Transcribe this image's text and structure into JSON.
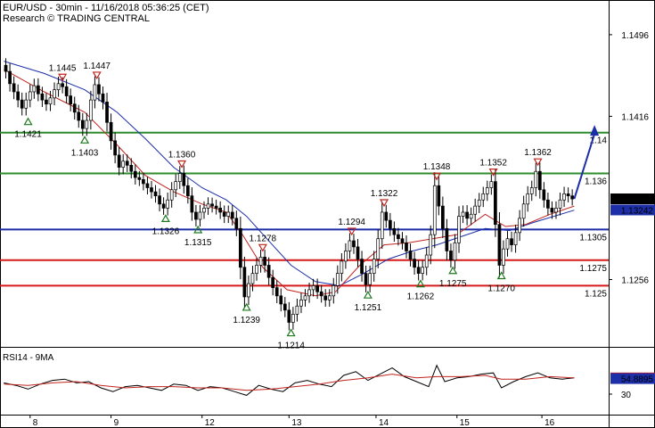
{
  "header": {
    "line1": "EUR/USD - 30min - 11/16/2018 05:36:25 (CET)",
    "line2": "Research © TRADING CENTRAL"
  },
  "rsi_panel_label": "RSI14 - 9MA",
  "chart_data": [
    {
      "type": "candlestick",
      "title": "EUR/USD - 30min - 11/16/2018 05:36:25 (CET)",
      "x_tick_labels": [
        "8",
        "9",
        "12",
        "13",
        "14",
        "15",
        "16"
      ],
      "y_tick_labels": [
        {
          "value": 1.1496,
          "label": "1.1496"
        },
        {
          "value": 1.1416,
          "label": "1.1416"
        },
        {
          "value": 1.1256,
          "label": "1.1256"
        }
      ],
      "ylim": [
        1.119,
        1.153
      ],
      "price_path": [
        [
          1,
          1.1466
        ],
        [
          3,
          1.146
        ],
        [
          5,
          1.1448
        ],
        [
          7,
          1.144
        ],
        [
          9,
          1.1432
        ],
        [
          11,
          1.1424
        ],
        [
          13,
          1.1432
        ],
        [
          15,
          1.144
        ],
        [
          17,
          1.1446
        ],
        [
          19,
          1.1438
        ],
        [
          21,
          1.1432
        ],
        [
          23,
          1.1428
        ],
        [
          25,
          1.1434
        ],
        [
          27,
          1.1442
        ],
        [
          29,
          1.1448
        ],
        [
          31,
          1.1445
        ],
        [
          33,
          1.1436
        ],
        [
          35,
          1.1428
        ],
        [
          37,
          1.142
        ],
        [
          39,
          1.1412
        ],
        [
          41,
          1.1404
        ],
        [
          43,
          1.1412
        ],
        [
          45,
          1.1432
        ],
        [
          47,
          1.1447
        ],
        [
          49,
          1.1438
        ],
        [
          51,
          1.143
        ],
        [
          53,
          1.141
        ],
        [
          55,
          1.1392
        ],
        [
          57,
          1.1378
        ],
        [
          59,
          1.1366
        ],
        [
          61,
          1.1372
        ],
        [
          63,
          1.1368
        ],
        [
          65,
          1.1362
        ],
        [
          67,
          1.1356
        ],
        [
          69,
          1.1354
        ],
        [
          71,
          1.135
        ],
        [
          73,
          1.1346
        ],
        [
          75,
          1.1342
        ],
        [
          77,
          1.1338
        ],
        [
          79,
          1.133
        ],
        [
          81,
          1.1326
        ],
        [
          83,
          1.1334
        ],
        [
          85,
          1.1344
        ],
        [
          87,
          1.1352
        ],
        [
          89,
          1.136
        ],
        [
          91,
          1.1348
        ],
        [
          93,
          1.1338
        ],
        [
          95,
          1.1322
        ],
        [
          97,
          1.1315
        ],
        [
          99,
          1.1322
        ],
        [
          101,
          1.1326
        ],
        [
          103,
          1.133
        ],
        [
          105,
          1.1328
        ],
        [
          107,
          1.1326
        ],
        [
          109,
          1.1322
        ],
        [
          111,
          1.1318
        ],
        [
          113,
          1.1322
        ],
        [
          115,
          1.1316
        ],
        [
          117,
          1.1306
        ],
        [
          119,
          1.1268
        ],
        [
          121,
          1.1239
        ],
        [
          123,
          1.1252
        ],
        [
          125,
          1.1262
        ],
        [
          127,
          1.127
        ],
        [
          129,
          1.1278
        ],
        [
          131,
          1.127
        ],
        [
          133,
          1.1258
        ],
        [
          135,
          1.1248
        ],
        [
          137,
          1.124
        ],
        [
          139,
          1.1232
        ],
        [
          141,
          1.1226
        ],
        [
          143,
          1.1214
        ],
        [
          145,
          1.1222
        ],
        [
          147,
          1.123
        ],
        [
          149,
          1.1236
        ],
        [
          151,
          1.124
        ],
        [
          153,
          1.1246
        ],
        [
          155,
          1.125
        ],
        [
          157,
          1.1244
        ],
        [
          159,
          1.124
        ],
        [
          161,
          1.1236
        ],
        [
          163,
          1.124
        ],
        [
          165,
          1.125
        ],
        [
          167,
          1.1262
        ],
        [
          169,
          1.1274
        ],
        [
          171,
          1.1284
        ],
        [
          173,
          1.1294
        ],
        [
          175,
          1.1288
        ],
        [
          177,
          1.1276
        ],
        [
          179,
          1.1262
        ],
        [
          181,
          1.1251
        ],
        [
          183,
          1.1262
        ],
        [
          185,
          1.1276
        ],
        [
          187,
          1.1296
        ],
        [
          189,
          1.1322
        ],
        [
          191,
          1.1314
        ],
        [
          193,
          1.1306
        ],
        [
          195,
          1.13
        ],
        [
          197,
          1.1296
        ],
        [
          199,
          1.1292
        ],
        [
          201,
          1.1284
        ],
        [
          203,
          1.1276
        ],
        [
          205,
          1.1268
        ],
        [
          207,
          1.1262
        ],
        [
          209,
          1.1268
        ],
        [
          211,
          1.128
        ],
        [
          213,
          1.13
        ],
        [
          215,
          1.1348
        ],
        [
          217,
          1.1328
        ],
        [
          219,
          1.1306
        ],
        [
          221,
          1.1284
        ],
        [
          223,
          1.1275
        ],
        [
          225,
          1.1292
        ],
        [
          227,
          1.1318
        ],
        [
          229,
          1.1322
        ],
        [
          231,
          1.1316
        ],
        [
          233,
          1.132
        ],
        [
          235,
          1.1328
        ],
        [
          237,
          1.1334
        ],
        [
          239,
          1.134
        ],
        [
          241,
          1.1346
        ],
        [
          243,
          1.1352
        ],
        [
          245,
          1.131
        ],
        [
          247,
          1.127
        ],
        [
          249,
          1.1286
        ],
        [
          251,
          1.1296
        ],
        [
          253,
          1.129
        ],
        [
          255,
          1.1302
        ],
        [
          257,
          1.1316
        ],
        [
          259,
          1.133
        ],
        [
          261,
          1.134
        ],
        [
          263,
          1.1346
        ],
        [
          265,
          1.1362
        ],
        [
          267,
          1.1344
        ],
        [
          269,
          1.1334
        ],
        [
          271,
          1.1326
        ],
        [
          273,
          1.1322
        ],
        [
          275,
          1.1326
        ],
        [
          277,
          1.1334
        ],
        [
          279,
          1.134
        ],
        [
          281,
          1.1338
        ],
        [
          283,
          1.1335
        ]
      ],
      "ma_fast": [
        [
          1,
          1.1462
        ],
        [
          21,
          1.144
        ],
        [
          41,
          1.142
        ],
        [
          57,
          1.1388
        ],
        [
          71,
          1.1358
        ],
        [
          85,
          1.1342
        ],
        [
          99,
          1.133
        ],
        [
          111,
          1.1322
        ],
        [
          119,
          1.13
        ],
        [
          129,
          1.1268
        ],
        [
          141,
          1.1246
        ],
        [
          155,
          1.124
        ],
        [
          165,
          1.1244
        ],
        [
          177,
          1.127
        ],
        [
          189,
          1.129
        ],
        [
          201,
          1.1292
        ],
        [
          213,
          1.1296
        ],
        [
          225,
          1.13
        ],
        [
          239,
          1.132
        ],
        [
          249,
          1.1308
        ],
        [
          259,
          1.131
        ],
        [
          271,
          1.132
        ],
        [
          283,
          1.1328
        ]
      ],
      "ma_slow": [
        [
          1,
          1.147
        ],
        [
          21,
          1.1458
        ],
        [
          41,
          1.1442
        ],
        [
          57,
          1.142
        ],
        [
          71,
          1.1394
        ],
        [
          85,
          1.1366
        ],
        [
          99,
          1.1346
        ],
        [
          111,
          1.1334
        ],
        [
          121,
          1.1318
        ],
        [
          131,
          1.1296
        ],
        [
          143,
          1.127
        ],
        [
          155,
          1.1254
        ],
        [
          167,
          1.125
        ],
        [
          179,
          1.1262
        ],
        [
          191,
          1.1276
        ],
        [
          203,
          1.1284
        ],
        [
          215,
          1.129
        ],
        [
          227,
          1.1298
        ],
        [
          239,
          1.1306
        ],
        [
          251,
          1.1304
        ],
        [
          263,
          1.1312
        ],
        [
          283,
          1.1324
        ]
      ],
      "hlines": [
        {
          "value": 1.14,
          "color": "#2e8b2e",
          "label": "1.14",
          "label_color": "#2e8b2e"
        },
        {
          "value": 1.136,
          "color": "#2e8b2e",
          "label": "1.136",
          "label_color": "#2e8b2e"
        },
        {
          "value": 1.1305,
          "color": "#1c2fa8",
          "label": "1.1305",
          "label_color": "#1c2fa8"
        },
        {
          "value": 1.1275,
          "color": "#d61a1a",
          "label": "1.1275",
          "label_color": "#d61a1a"
        },
        {
          "value": 1.125,
          "color": "#d61a1a",
          "label": "1.125",
          "label_color": "#d61a1a"
        }
      ],
      "price_tags": [
        {
          "label": "1.13351",
          "bg": "#000000",
          "fg": "#ffffff",
          "value": 1.13351
        },
        {
          "label": "1.13242",
          "bg": "#1c2fa8",
          "fg": "#ffffff",
          "value": 1.13242
        }
      ],
      "annotations": [
        {
          "label": "1.1445",
          "x": 30,
          "value": 1.1445,
          "kind": "high"
        },
        {
          "label": "1.1447",
          "x": 47,
          "value": 1.1447,
          "kind": "high"
        },
        {
          "label": "1.1421",
          "x": 13,
          "value": 1.1421,
          "kind": "low"
        },
        {
          "label": "1.1403",
          "x": 41,
          "value": 1.1403,
          "kind": "low"
        },
        {
          "label": "1.1360",
          "x": 89,
          "value": 1.136,
          "kind": "high"
        },
        {
          "label": "1.1326",
          "x": 81,
          "value": 1.1326,
          "kind": "low"
        },
        {
          "label": "1.1315",
          "x": 97,
          "value": 1.1315,
          "kind": "low"
        },
        {
          "label": "1.1278",
          "x": 129,
          "value": 1.1278,
          "kind": "high"
        },
        {
          "label": "1.1239",
          "x": 121,
          "value": 1.1239,
          "kind": "low"
        },
        {
          "label": "1.1214",
          "x": 143,
          "value": 1.1214,
          "kind": "low"
        },
        {
          "label": "1.1294",
          "x": 173,
          "value": 1.1294,
          "kind": "high"
        },
        {
          "label": "1.1322",
          "x": 189,
          "value": 1.1322,
          "kind": "high"
        },
        {
          "label": "1.1251",
          "x": 181,
          "value": 1.1251,
          "kind": "low"
        },
        {
          "label": "1.1348",
          "x": 215,
          "value": 1.1348,
          "kind": "high"
        },
        {
          "label": "1.1262",
          "x": 207,
          "value": 1.1262,
          "kind": "low"
        },
        {
          "label": "1.1275",
          "x": 223,
          "value": 1.1275,
          "kind": "low"
        },
        {
          "label": "1.1352",
          "x": 243,
          "value": 1.1352,
          "kind": "high"
        },
        {
          "label": "1.1270",
          "x": 247,
          "value": 1.127,
          "kind": "low"
        },
        {
          "label": "1.1362",
          "x": 265,
          "value": 1.1362,
          "kind": "high"
        }
      ],
      "forecast_arrow": {
        "from": [
          283,
          1.1335
        ],
        "to": [
          293,
          1.1404
        ],
        "color": "#1c2fa8"
      }
    },
    {
      "type": "line",
      "title": "RSI14 - 9MA",
      "ylim": [
        0,
        100
      ],
      "y_tick_labels": [
        {
          "value": 30,
          "label": "30"
        }
      ],
      "rsi": [
        [
          1,
          48
        ],
        [
          7,
          44
        ],
        [
          13,
          38
        ],
        [
          19,
          46
        ],
        [
          25,
          52
        ],
        [
          31,
          54
        ],
        [
          37,
          48
        ],
        [
          43,
          50
        ],
        [
          49,
          40
        ],
        [
          55,
          34
        ],
        [
          61,
          42
        ],
        [
          67,
          44
        ],
        [
          73,
          40
        ],
        [
          79,
          36
        ],
        [
          85,
          46
        ],
        [
          91,
          44
        ],
        [
          97,
          36
        ],
        [
          103,
          42
        ],
        [
          109,
          40
        ],
        [
          115,
          34
        ],
        [
          121,
          28
        ],
        [
          127,
          44
        ],
        [
          133,
          38
        ],
        [
          139,
          34
        ],
        [
          145,
          48
        ],
        [
          151,
          52
        ],
        [
          157,
          46
        ],
        [
          163,
          42
        ],
        [
          169,
          60
        ],
        [
          175,
          66
        ],
        [
          181,
          52
        ],
        [
          187,
          62
        ],
        [
          193,
          72
        ],
        [
          199,
          58
        ],
        [
          205,
          50
        ],
        [
          211,
          42
        ],
        [
          215,
          76
        ],
        [
          219,
          50
        ],
        [
          225,
          56
        ],
        [
          231,
          58
        ],
        [
          237,
          62
        ],
        [
          243,
          64
        ],
        [
          247,
          40
        ],
        [
          253,
          50
        ],
        [
          259,
          58
        ],
        [
          265,
          64
        ],
        [
          271,
          56
        ],
        [
          277,
          54
        ],
        [
          283,
          56
        ]
      ],
      "ma9": [
        [
          1,
          46
        ],
        [
          13,
          44
        ],
        [
          25,
          48
        ],
        [
          37,
          50
        ],
        [
          49,
          44
        ],
        [
          61,
          40
        ],
        [
          73,
          42
        ],
        [
          85,
          42
        ],
        [
          97,
          40
        ],
        [
          109,
          40
        ],
        [
          121,
          36
        ],
        [
          133,
          38
        ],
        [
          145,
          42
        ],
        [
          157,
          46
        ],
        [
          169,
          52
        ],
        [
          181,
          56
        ],
        [
          193,
          62
        ],
        [
          205,
          56
        ],
        [
          215,
          58
        ],
        [
          227,
          58
        ],
        [
          239,
          60
        ],
        [
          247,
          54
        ],
        [
          259,
          54
        ],
        [
          271,
          58
        ],
        [
          283,
          56
        ]
      ],
      "tags": [
        {
          "label": "55.9476",
          "bg": "#d61a1a",
          "fg": "#ffffff",
          "value": 55.9476
        },
        {
          "label": "54.8895",
          "bg": "#1c2fa8",
          "fg": "#ffffff",
          "value": 54.8895
        }
      ]
    }
  ]
}
